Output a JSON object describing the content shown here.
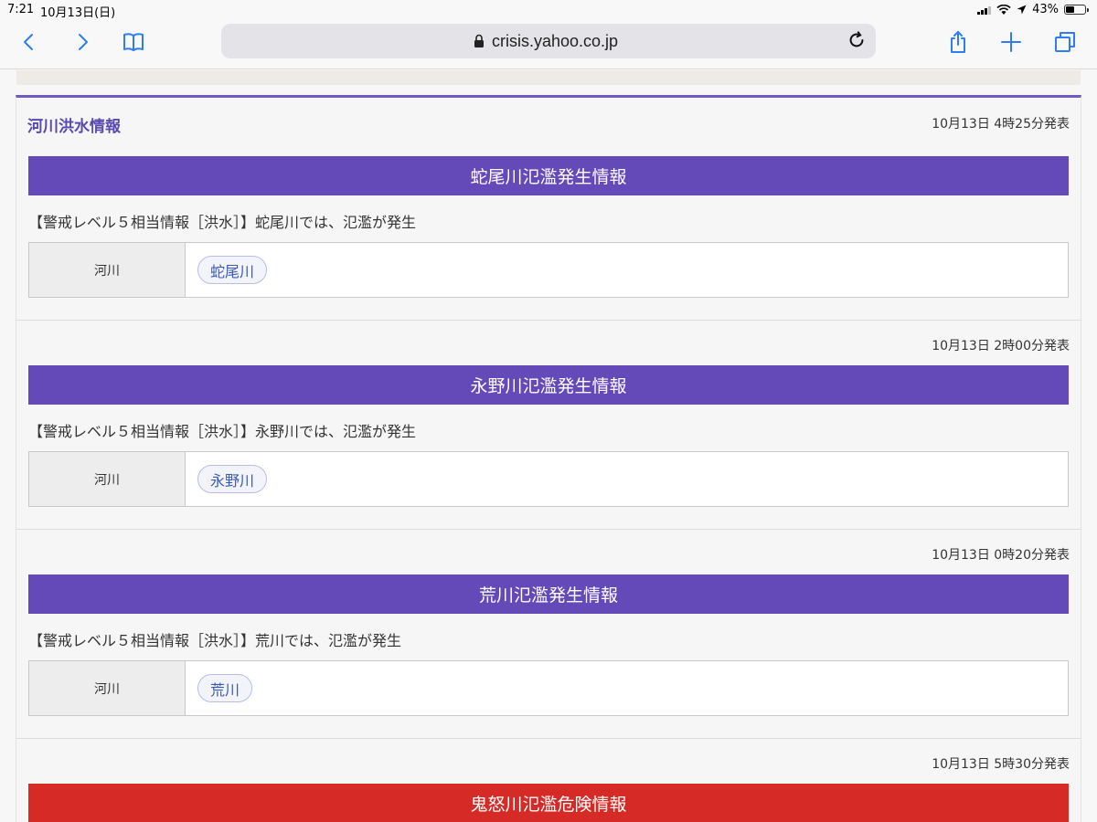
{
  "status_bar": {
    "time": "7:21",
    "date": "10月13日(日)",
    "battery": "43%",
    "battery_level": 0.43
  },
  "browser": {
    "url": "crisis.yahoo.co.jp",
    "accent_color": "#2f7cf6"
  },
  "section": {
    "title": "河川洪水情報",
    "title_color": "#5a4aad"
  },
  "entries": [
    {
      "issued": "10月13日 4時25分発表",
      "headline": "蛇尾川氾濫発生情報",
      "headline_color": "#6449b8",
      "description": "【警戒レベル５相当情報［洪水］】蛇尾川では、氾濫が発生",
      "table_label": "河川",
      "river": "蛇尾川"
    },
    {
      "issued": "10月13日 2時00分発表",
      "headline": "永野川氾濫発生情報",
      "headline_color": "#6449b8",
      "description": "【警戒レベル５相当情報［洪水］】永野川では、氾濫が発生",
      "table_label": "河川",
      "river": "永野川"
    },
    {
      "issued": "10月13日 0時20分発表",
      "headline": "荒川氾濫発生情報",
      "headline_color": "#6449b8",
      "description": "【警戒レベル５相当情報［洪水］】荒川では、氾濫が発生",
      "table_label": "河川",
      "river": "荒川"
    },
    {
      "issued": "10月13日 5時30分発表",
      "headline": "鬼怒川氾濫危険情報",
      "headline_color": "#d52a26"
    }
  ]
}
